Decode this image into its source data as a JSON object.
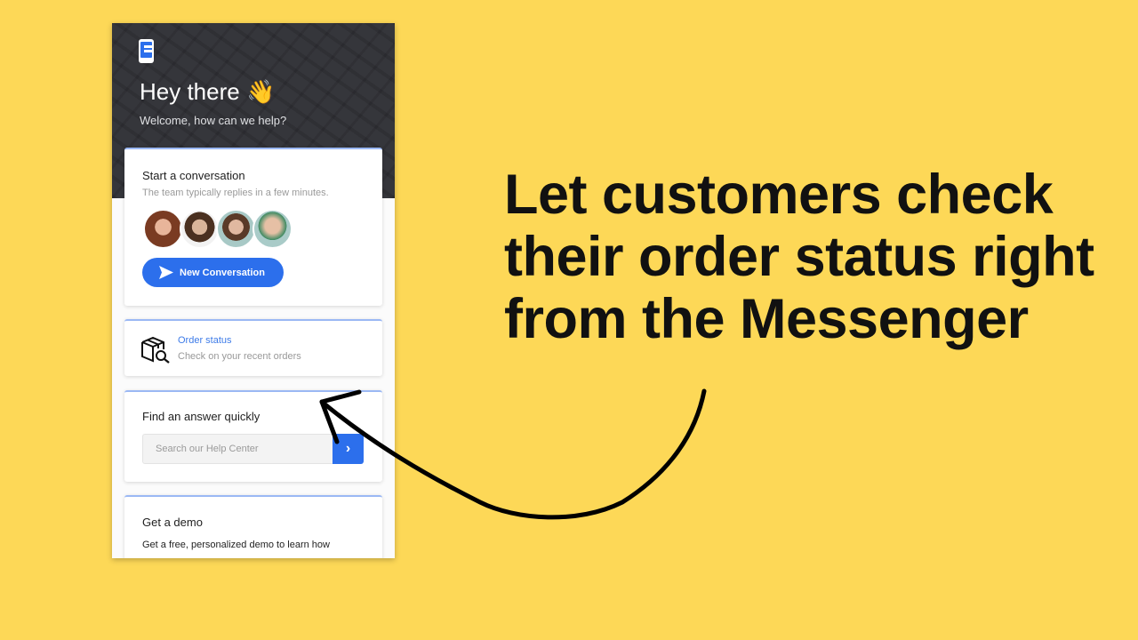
{
  "messenger": {
    "greeting": "Hey there 👋",
    "welcome": "Welcome, how can we help?",
    "conversation": {
      "title": "Start a conversation",
      "subtitle": "The team typically replies in a few minutes.",
      "button": "New Conversation"
    },
    "order_status": {
      "title": "Order status",
      "subtitle": "Check on your recent orders"
    },
    "find_answer": {
      "title": "Find an answer quickly",
      "search_placeholder": "Search our Help Center"
    },
    "demo": {
      "title": "Get a demo",
      "text": "Get a free, personalized demo to learn how"
    }
  },
  "headline": "Let customers check their order status right from the Messenger",
  "colors": {
    "background": "#FDD857",
    "accent": "#2c6fec"
  }
}
